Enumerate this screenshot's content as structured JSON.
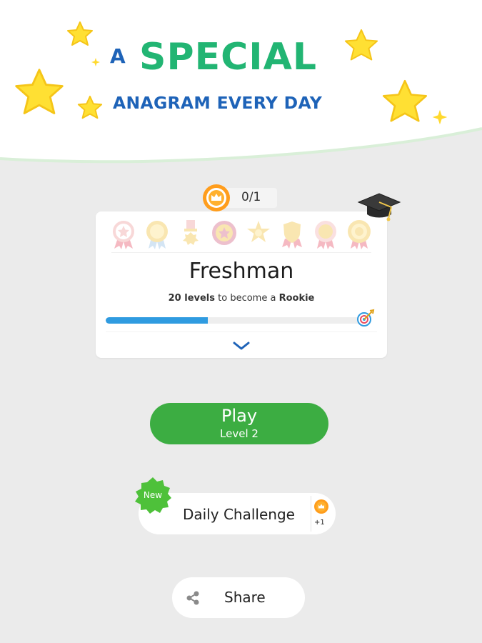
{
  "promo": {
    "headline_a": "A",
    "headline_special": "SPECIAL",
    "headline_sub": "ANAGRAM EVERY DAY"
  },
  "progress": {
    "crown_count": "0/1",
    "rank_title": "Freshman",
    "levels_needed": "20 levels",
    "to_become": "to become a",
    "next_rank": "Rookie",
    "progress_fraction": 0.4
  },
  "medals": [
    {
      "icon": "medal-star-pink-icon"
    },
    {
      "icon": "medal-gold-round-icon"
    },
    {
      "icon": "medal-ribbon-cross-icon"
    },
    {
      "icon": "medal-red-star-icon"
    },
    {
      "icon": "medal-sheriff-star-icon"
    },
    {
      "icon": "medal-shield-icon"
    },
    {
      "icon": "medal-pink-round-icon"
    },
    {
      "icon": "medal-gold-sun-icon"
    }
  ],
  "play": {
    "label": "Play",
    "level": "Level 2"
  },
  "daily": {
    "badge": "New",
    "label": "Daily Challenge",
    "reward": "+1"
  },
  "share": {
    "label": "Share"
  },
  "colors": {
    "green_headline": "#22b573",
    "blue_headline": "#1e63b8",
    "play_green": "#3cad42",
    "progress_blue": "#2f9be0",
    "star_yellow": "#ffe033"
  }
}
